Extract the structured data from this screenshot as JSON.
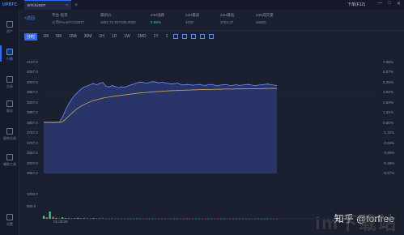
{
  "app": {
    "brand": "UPBTC",
    "tab_label": "BTC/USDT",
    "tab_close": "×",
    "tab_add": "+",
    "window_title": "下单(F12)",
    "win_min": "—",
    "win_max": "□",
    "win_close": "✕"
  },
  "sidebar": {
    "items": [
      {
        "label": "资产",
        "icon": "wallet-icon"
      },
      {
        "label": "行情",
        "icon": "chart-icon"
      },
      {
        "label": "交易",
        "icon": "exchange-icon"
      },
      {
        "label": "量化",
        "icon": "robot-icon"
      },
      {
        "label": "跟单交易",
        "icon": "copy-trade-icon"
      },
      {
        "label": "辅助工具",
        "icon": "tools-icon"
      },
      {
        "label": "设置",
        "icon": "settings-icon"
      }
    ],
    "active_index": 1
  },
  "header": {
    "back_label": "<返回",
    "pair_label": "平台-现货",
    "pair_value": "火币Pro-BTC/USDT",
    "last_price_label": "最新价",
    "last_price_value": "3991.74 ¥27336.6330",
    "change_label": "24H涨跌",
    "change_value": "5.99%",
    "high_label": "24H最高",
    "high_value": "4030",
    "low_label": "24H最低",
    "low_value": "3763.37",
    "volume_label": "24H成交量",
    "volume_value": "26600"
  },
  "toolbar": {
    "intervals": [
      "分时",
      "1M",
      "5M",
      "15M",
      "30M",
      "1H",
      "1D",
      "1W",
      "1MO",
      "1Y",
      "1"
    ],
    "active_index": 0,
    "tool_icons": [
      "draw-line-icon",
      "indicator-icon",
      "crosshair-icon",
      "compare-icon",
      "fullscreen-icon"
    ]
  },
  "colors": {
    "accent": "#2f6bff",
    "up": "#3ccf8c",
    "down": "#ef5350",
    "price_line": "#6f8dff",
    "avg_line": "#d9b25a"
  },
  "chart_data": {
    "type": "area",
    "price_axis": [
      "4107.0",
      "4057.0",
      "4007.0",
      "3957.0",
      "3907.0",
      "3857.0",
      "3807.0",
      "3757.0",
      "3707.0",
      "3657.0",
      "3607.0",
      "3557.0"
    ],
    "pct_axis": [
      "7.88%",
      "6.57%",
      "5.25%",
      "3.94%",
      "2.63%",
      "1.31%",
      "0.00%",
      "-1.31%",
      "-2.63%",
      "-3.94%",
      "-5.25%",
      "-6.57%"
    ],
    "ylim": [
      3557,
      4107
    ],
    "base_price": 3807,
    "volume_axis": [
      "1000.0",
      "500.0"
    ],
    "volume_ylim": [
      0,
      1000
    ],
    "time_label": "01:30:00",
    "price_series": [
      3812,
      3809,
      3811,
      3808,
      3812,
      3810,
      3835,
      3870,
      3900,
      3925,
      3945,
      3960,
      3975,
      3985,
      3990,
      3998,
      4002,
      3996,
      4003,
      4008,
      3990,
      3985,
      3992,
      3988,
      3980,
      3986,
      3983,
      3990,
      3995,
      4000,
      4006,
      4010,
      4008,
      4004,
      4007,
      4012,
      4010,
      4005,
      4009,
      4006,
      4003,
      4000,
      4002,
      4005,
      3998,
      3995,
      3998,
      3997,
      3994,
      3996,
      3998,
      3995,
      3993,
      3996,
      3998,
      3994,
      3992,
      3995,
      3997,
      3996,
      3992,
      3994,
      3996,
      3993,
      3995,
      3997,
      3998,
      3994,
      3992,
      3995,
      3996,
      3998,
      4000,
      3997,
      3995,
      3992
    ],
    "avg_series": [
      3810,
      3810,
      3810,
      3810,
      3810,
      3810,
      3812,
      3825,
      3840,
      3855,
      3868,
      3880,
      3890,
      3898,
      3906,
      3912,
      3918,
      3922,
      3926,
      3930,
      3933,
      3935,
      3938,
      3940,
      3942,
      3944,
      3946,
      3948,
      3950,
      3952,
      3954,
      3956,
      3957,
      3958,
      3960,
      3961,
      3962,
      3963,
      3964,
      3965,
      3966,
      3967,
      3967,
      3968,
      3969,
      3969,
      3970,
      3970,
      3971,
      3971,
      3972,
      3972,
      3973,
      3973,
      3973,
      3974,
      3974,
      3974,
      3975,
      3975,
      3975,
      3975,
      3976,
      3976,
      3976,
      3976,
      3977,
      3977,
      3977,
      3977,
      3977,
      3978,
      3978,
      3978,
      3978,
      3978
    ],
    "volume_series": [
      120,
      60,
      300,
      80,
      40,
      20,
      60,
      30,
      25,
      15,
      20,
      35,
      18,
      22,
      12,
      10,
      28,
      14,
      9,
      16,
      11,
      8,
      13,
      10,
      7,
      9,
      12,
      8,
      6,
      10,
      9,
      7,
      8,
      11,
      6,
      5,
      9,
      7,
      6,
      8,
      5,
      7,
      6,
      9,
      5,
      6,
      8,
      4,
      7,
      5,
      6,
      4,
      5,
      7,
      6,
      4,
      5,
      6,
      5,
      4,
      6,
      5,
      4,
      5,
      6,
      4,
      5,
      3,
      4,
      6,
      5,
      4,
      5,
      3,
      4,
      6
    ]
  },
  "watermark": {
    "text": "知乎 @forfree",
    "bottom_text": "im下载站"
  }
}
